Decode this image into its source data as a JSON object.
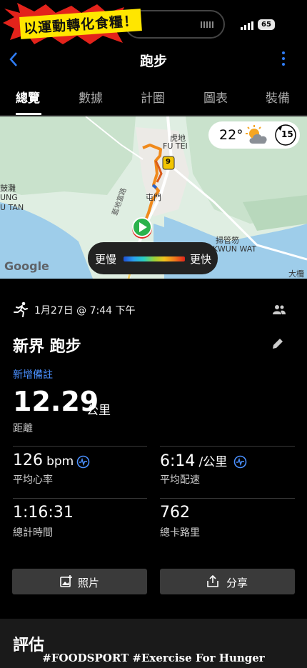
{
  "banner": {
    "text": "以運動轉化食糧！"
  },
  "status": {
    "battery": "65"
  },
  "header": {
    "title": "跑步",
    "back_icon": "chevron-left-icon",
    "more_icon": "vertical-dots-icon"
  },
  "tabs": [
    {
      "label": "總覽",
      "active": true
    },
    {
      "label": "數據",
      "active": false
    },
    {
      "label": "計圈",
      "active": false
    },
    {
      "label": "圖表",
      "active": false
    },
    {
      "label": "裝備",
      "active": false
    }
  ],
  "map": {
    "labels": {
      "fu_tei_cn": "虎地",
      "fu_tei_en": "FU TEI",
      "route_no": "9",
      "left_cn": "鼓灘",
      "left_en1": "UNG",
      "left_en2": "U TAN",
      "tuen_mun": "屯門",
      "road": "藍地富路",
      "so_kwun_wat_cn": "掃管笏",
      "so_kwun_wat_en": "KWUN WAT",
      "google": "Google",
      "corner": "大欖"
    },
    "weather": {
      "temp": "22°",
      "wind": "15"
    },
    "legend": {
      "slow": "更慢",
      "fast": "更快"
    }
  },
  "activity": {
    "date": "1月27日 @ 7:44 下午",
    "title": "新界 跑步",
    "add_note": "新增備註",
    "distance": {
      "value": "12.29",
      "unit": "公里",
      "label": "距離"
    },
    "stats": [
      {
        "value": "126",
        "unit": "bpm",
        "label": "平均心率"
      },
      {
        "value": "6:14",
        "unit": "/公里",
        "label": "平均配速"
      },
      {
        "value": "1:16:31",
        "unit": "",
        "label": "總計時間"
      },
      {
        "value": "762",
        "unit": "",
        "label": "總卡路里"
      }
    ]
  },
  "buttons": {
    "photos": "照片",
    "share": "分享"
  },
  "section": {
    "title": "評估"
  },
  "watermark": "#FOODSPORT #Exercise For Hunger",
  "colors": {
    "accent": "#2f7df6",
    "link": "#4a90ff",
    "route": "#f08a1c"
  }
}
